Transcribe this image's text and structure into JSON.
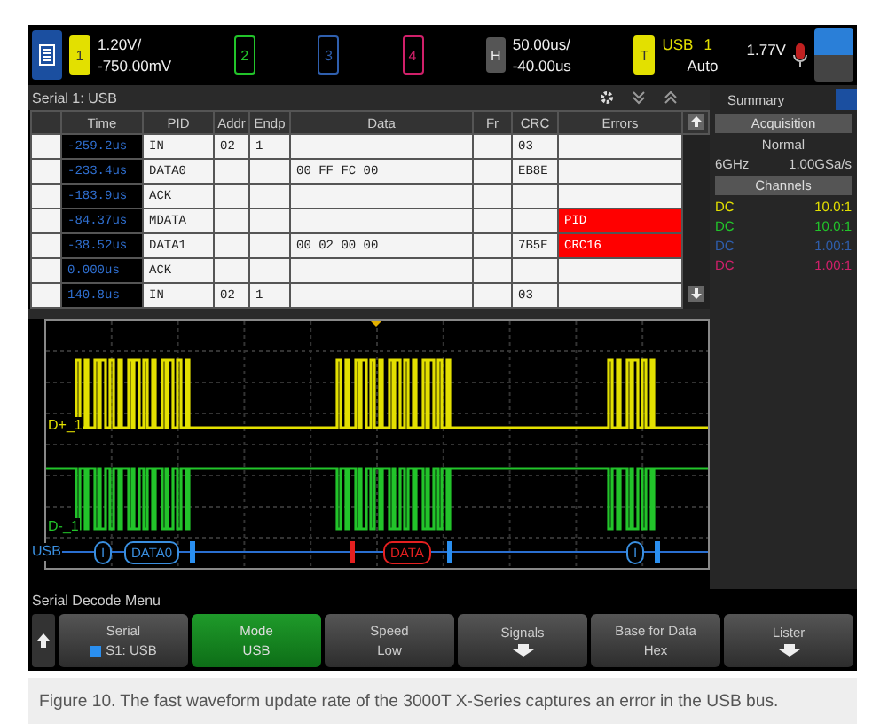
{
  "top_bar": {
    "channels": [
      {
        "label": "1",
        "color": "#e3e000",
        "on": true,
        "scale": "1.20V/",
        "offset": "-750.00mV"
      },
      {
        "label": "2",
        "color": "#22c42a",
        "on": false
      },
      {
        "label": "3",
        "color": "#2f5fae",
        "on": false
      },
      {
        "label": "4",
        "color": "#d0206a",
        "on": false
      }
    ],
    "horizontal": {
      "label": "H",
      "scale": "50.00us/",
      "delay": "-40.00us"
    },
    "trigger": {
      "label": "T",
      "source": "USB",
      "channel": "1",
      "mode": "Auto",
      "level": "1.77V"
    }
  },
  "lister": {
    "title": "Serial 1: USB",
    "columns": [
      "Time",
      "PID",
      "Addr",
      "Endp",
      "Data",
      "Fr",
      "CRC",
      "Errors"
    ],
    "rows": [
      {
        "cells": [
          "-259.2us",
          "IN",
          "02",
          "1",
          "",
          "",
          "03",
          ""
        ],
        "error": false
      },
      {
        "cells": [
          "-233.4us",
          "DATA0",
          "",
          "",
          "00 FF FC 00",
          "",
          "EB8E",
          ""
        ],
        "error": false
      },
      {
        "cells": [
          "-183.9us",
          "ACK",
          "",
          "",
          "",
          "",
          "",
          ""
        ],
        "error": false
      },
      {
        "cells": [
          "-84.37us",
          "MDATA",
          "",
          "",
          "",
          "",
          "",
          "PID"
        ],
        "error": true
      },
      {
        "cells": [
          "-38.52us",
          "DATA1",
          "",
          "",
          "00 02 00 00",
          "",
          "7B5E",
          "CRC16"
        ],
        "error": true
      },
      {
        "cells": [
          "0.000us",
          "ACK",
          "",
          "",
          "",
          "",
          "",
          ""
        ],
        "error": false
      },
      {
        "cells": [
          "140.8us",
          "IN",
          "02",
          "1",
          "",
          "",
          "03",
          ""
        ],
        "error": false
      }
    ]
  },
  "summary": {
    "title": "Summary",
    "acquisition_heading": "Acquisition",
    "mode": "Normal",
    "bandwidth": "6GHz",
    "sample_rate": "1.00GSa/s",
    "channels_heading": "Channels",
    "channels": [
      {
        "coupling": "DC",
        "probe": "10.0:1",
        "color": "#e3e000"
      },
      {
        "coupling": "DC",
        "probe": "10.0:1",
        "color": "#22c42a"
      },
      {
        "coupling": "DC",
        "probe": "1.00:1",
        "color": "#2f5fae"
      },
      {
        "coupling": "DC",
        "probe": "1.00:1",
        "color": "#d0206a"
      }
    ]
  },
  "waveform": {
    "traces": [
      {
        "label": "D+_1",
        "color": "#e3e000"
      },
      {
        "label": "D-_1",
        "color": "#22c42a"
      }
    ],
    "bus_label": "USB",
    "decode": [
      {
        "kind": "packet",
        "text": "I",
        "color": "#3a8fe0"
      },
      {
        "kind": "packet",
        "text": "DATA0",
        "color": "#3a8fe0"
      },
      {
        "kind": "marker",
        "color": "#2a8ff0"
      },
      {
        "kind": "marker",
        "color": "#e52020"
      },
      {
        "kind": "packet",
        "text": "DATA",
        "color": "#e52020"
      },
      {
        "kind": "marker",
        "color": "#2a8ff0"
      },
      {
        "kind": "packet",
        "text": "I",
        "color": "#3a8fe0"
      },
      {
        "kind": "marker",
        "color": "#2a8ff0"
      }
    ]
  },
  "menu": {
    "title": "Serial Decode Menu",
    "softkeys": [
      {
        "kind": "value",
        "label": "Serial",
        "value": "S1: USB",
        "selected": false,
        "color": "#2a8ff0"
      },
      {
        "kind": "value",
        "label": "Mode",
        "value": "USB",
        "selected": true
      },
      {
        "kind": "value",
        "label": "Speed",
        "value": "Low",
        "selected": false
      },
      {
        "kind": "submenu",
        "label": "Signals",
        "selected": false
      },
      {
        "kind": "value",
        "label": "Base for Data",
        "value": "Hex",
        "selected": false
      },
      {
        "kind": "submenu",
        "label": "Lister",
        "selected": false
      }
    ]
  },
  "caption": "Figure 10. The fast waveform update rate of the 3000T X-Series captures an error in the USB bus."
}
